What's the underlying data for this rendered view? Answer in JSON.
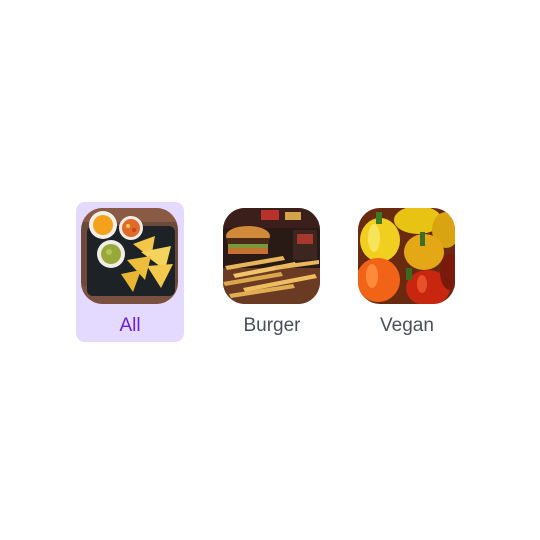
{
  "categories": [
    {
      "label": "All",
      "selected": true,
      "image": "nachos-and-dips-photo"
    },
    {
      "label": "Burger",
      "selected": false,
      "image": "burger-and-fries-photo"
    },
    {
      "label": "Vegan",
      "selected": false,
      "image": "bell-peppers-photo"
    }
  ],
  "colors": {
    "selected_background": "#e4d9ff",
    "selected_label": "#6a1fe0",
    "label": "#4b4f58",
    "page_background": "#ffffff"
  }
}
